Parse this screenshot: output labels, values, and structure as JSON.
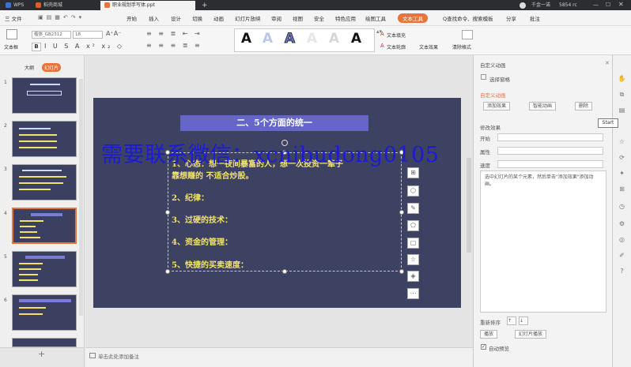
{
  "titlebar": {
    "tabs": [
      {
        "label": "WPS",
        "color": "#3f6fd8"
      },
      {
        "label": "稻壳商城",
        "color": "#e05a2b"
      },
      {
        "label": "职业规划手写体.ppt",
        "color": "#e8743b"
      }
    ],
    "new_tab": "+",
    "user": "千金一诺",
    "info": "5854 rc"
  },
  "menu": {
    "items": [
      "三 文件",
      "开始",
      "插入",
      "设计",
      "切换",
      "动画",
      "幻灯片放映",
      "审阅",
      "视图",
      "安全",
      "特色应用",
      "绘图工具",
      "文本工具"
    ],
    "active": "文本工具",
    "search": "Q查找命令、搜索模板",
    "share": "分享",
    "comment": "批注"
  },
  "ribbon": {
    "textbox_label": "文本框",
    "font_name": "楷体_GB2312",
    "font_size": "18",
    "text_fill": "文本填充",
    "text_outline": "文本轮廓",
    "text_effect": "文本效果",
    "clear_format": "清除格式",
    "fx_letter": "A"
  },
  "leftpanel": {
    "tab_outline": "大纲",
    "tab_slides": "幻灯片",
    "thumbs": [
      "1",
      "2",
      "3",
      "4",
      "5",
      "6"
    ],
    "add": "+"
  },
  "slide": {
    "title": "二、5个方面的统一",
    "lines": [
      "1、心态：想一夜间暴富的人，想一次投资一辈子",
      "靠想赚的 不适合炒股。",
      "2、纪律：",
      "3、过硬的技术：",
      "4、资金的管理：",
      "5、快捷的买卖速度："
    ]
  },
  "watermark": "需要联系微信：xcnibudong0105",
  "status": {
    "notes": "单击此处添加备注"
  },
  "rightpane": {
    "title": "自定义动画",
    "select_pane": "选择窗格",
    "custom_anim": "自定义动画",
    "add_effect": "添加效果",
    "smart_anim": "智能动画",
    "delete": "删除",
    "modify": "修改效果",
    "start": "开始",
    "property": "属性",
    "speed": "速度",
    "hint": "选中幻灯片的某个元素，然后单击\"添加效果\"添加动画。",
    "reorder": "重新排序",
    "play": "播放",
    "slideshow": "幻灯片播放",
    "autopreview": "自动预览"
  },
  "tooltip": "Start"
}
